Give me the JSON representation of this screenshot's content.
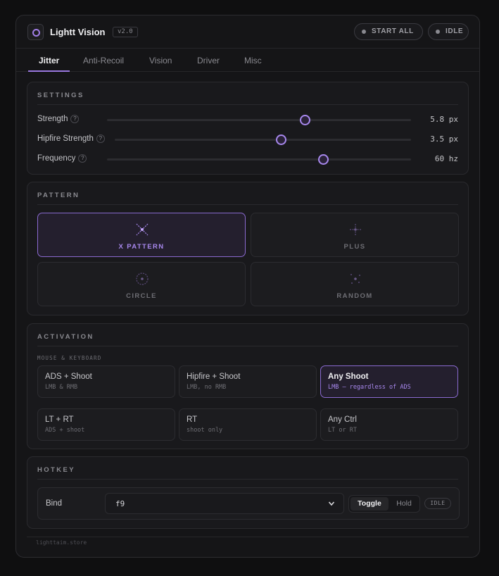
{
  "app": {
    "title": "Lightt Vision",
    "version": "v2.0"
  },
  "header": {
    "start_all_label": "START ALL",
    "status_label": "IDLE",
    "status_color": "#8a8a90"
  },
  "tabs": [
    {
      "label": "Jitter",
      "active": true
    },
    {
      "label": "Anti-Recoil",
      "active": false
    },
    {
      "label": "Vision",
      "active": false
    },
    {
      "label": "Driver",
      "active": false
    },
    {
      "label": "Misc",
      "active": false
    }
  ],
  "settings": {
    "title": "SETTINGS",
    "help_glyph": "?",
    "sliders": [
      {
        "label": "Strength",
        "value_text": "5.8 px",
        "fraction": 0.65
      },
      {
        "label": "Hipfire Strength",
        "value_text": "3.5 px",
        "fraction": 0.56
      },
      {
        "label": "Frequency",
        "value_text": "60 hz",
        "fraction": 0.71
      }
    ]
  },
  "pattern": {
    "title": "PATTERN",
    "options": [
      {
        "label": "X PATTERN",
        "icon": "x-pattern-icon",
        "selected": true
      },
      {
        "label": "PLUS",
        "icon": "plus-pattern-icon",
        "selected": false
      },
      {
        "label": "CIRCLE",
        "icon": "circle-pattern-icon",
        "selected": false
      },
      {
        "label": "RANDOM",
        "icon": "random-pattern-icon",
        "selected": false
      }
    ]
  },
  "activation": {
    "title": "ACTIVATION",
    "group_label": "MOUSE & KEYBOARD",
    "mouse_keyboard": [
      {
        "title": "ADS + Shoot",
        "desc": "LMB & RMB",
        "selected": false
      },
      {
        "title": "Hipfire + Shoot",
        "desc": "LMB, no RMB",
        "selected": false
      },
      {
        "title": "Any Shoot",
        "desc": "LMB — regardless of ADS",
        "selected": true
      }
    ],
    "controller": [
      {
        "title": "LT + RT",
        "desc": "ADS + shoot",
        "selected": false
      },
      {
        "title": "RT",
        "desc": "shoot only",
        "selected": false
      },
      {
        "title": "Any Ctrl",
        "desc": "LT or RT",
        "selected": false
      }
    ]
  },
  "hotkey": {
    "title": "HOTKEY",
    "bind_label": "Bind",
    "bind_value": "f9",
    "mode_toggle": "Toggle",
    "mode_hold": "Hold",
    "mode_selected": "Toggle",
    "status": "IDLE"
  },
  "footer": {
    "text": "lighttaim.store"
  },
  "colors": {
    "accent": "#a888ee",
    "background": "#0f0f10",
    "panel": "#19191c"
  }
}
